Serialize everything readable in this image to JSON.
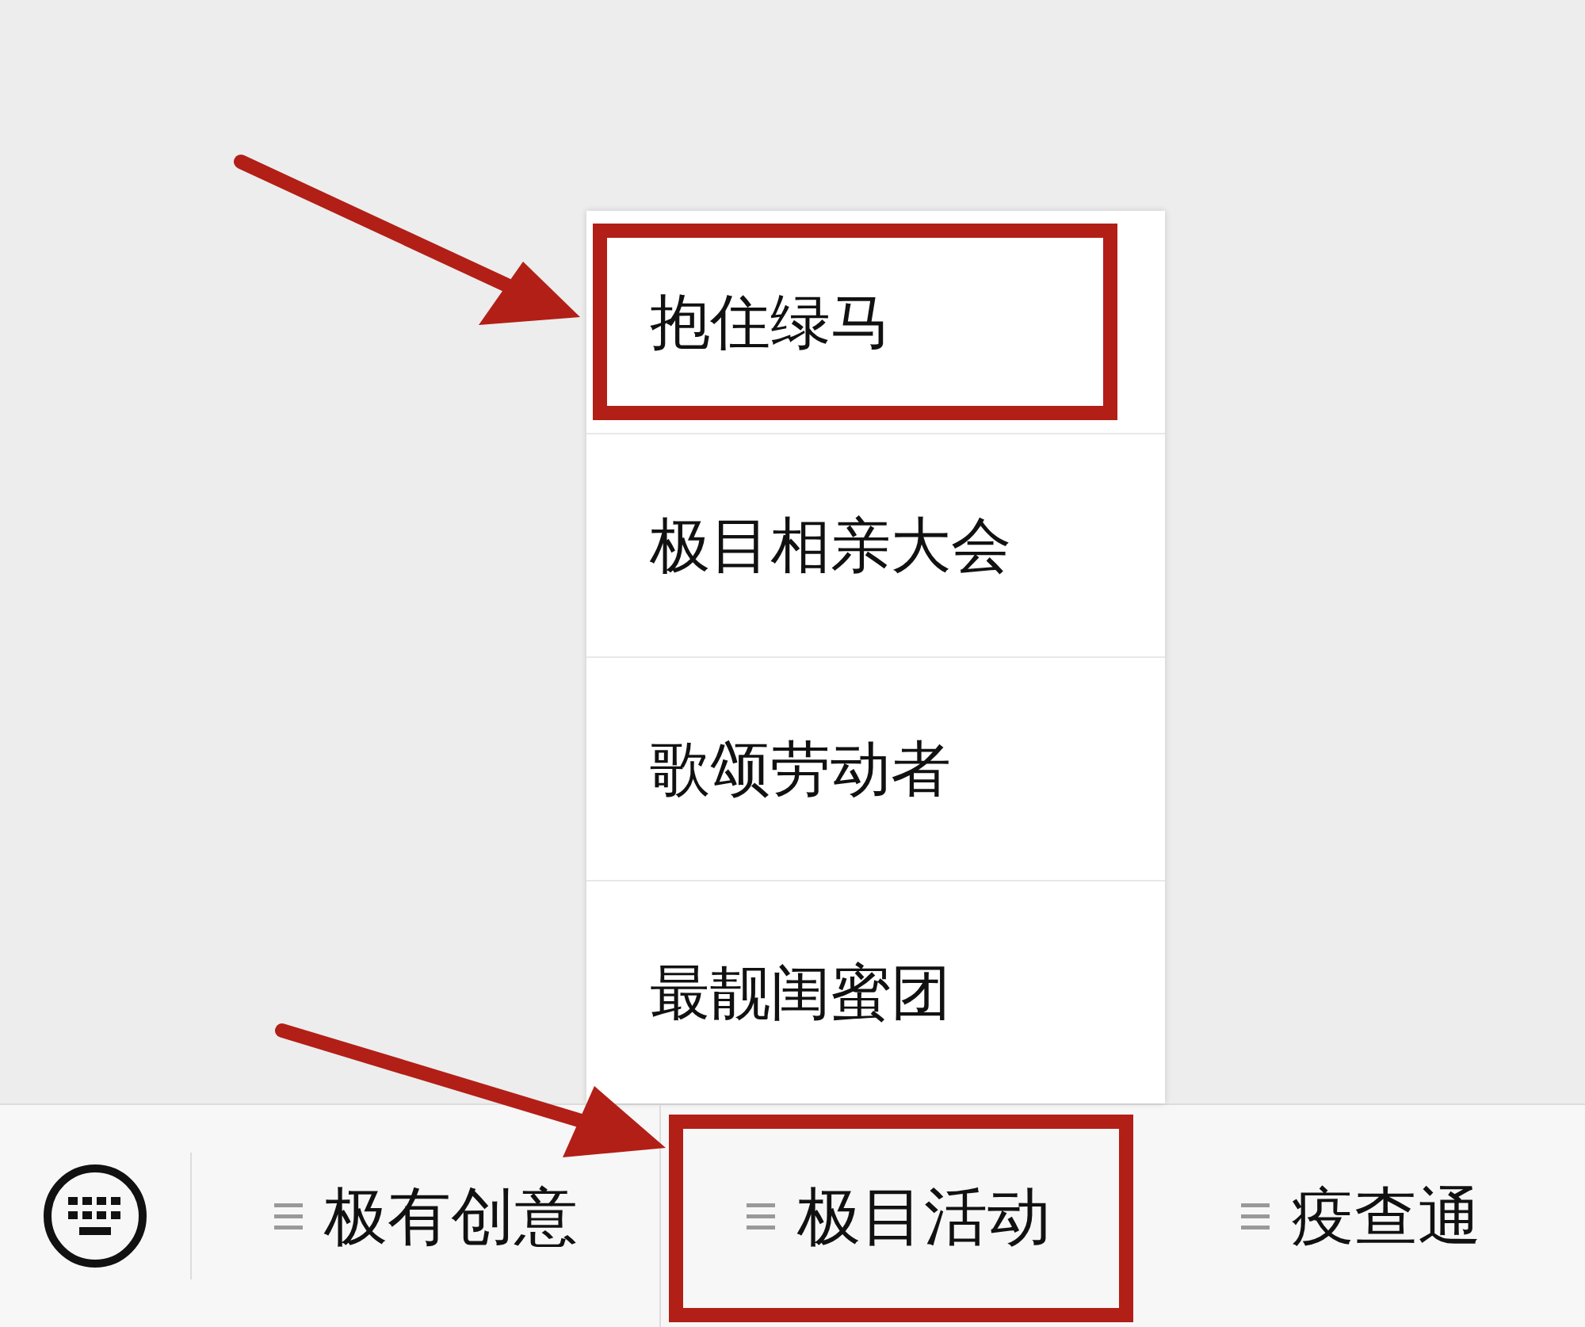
{
  "bottom_bar": {
    "tabs": [
      {
        "label": "极有创意",
        "expanded": false,
        "highlighted": false
      },
      {
        "label": "极目活动",
        "expanded": true,
        "highlighted": true,
        "submenu": [
          {
            "label": "抱住绿马",
            "highlighted": true
          },
          {
            "label": "极目相亲大会",
            "highlighted": false
          },
          {
            "label": "歌颂劳动者",
            "highlighted": false
          },
          {
            "label": "最靓闺蜜团",
            "highlighted": false
          }
        ]
      },
      {
        "label": "疫查通",
        "expanded": false,
        "highlighted": false
      }
    ]
  }
}
